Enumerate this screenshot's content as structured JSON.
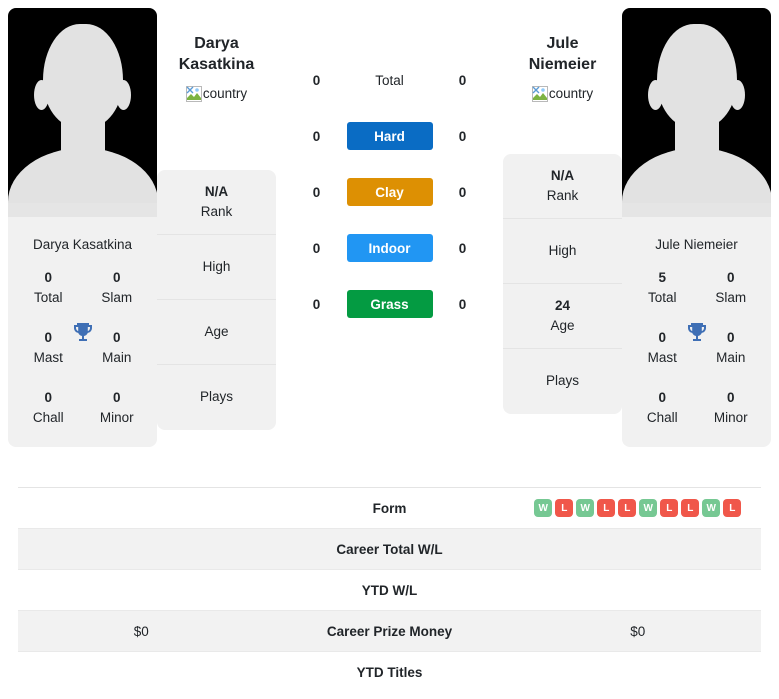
{
  "players": {
    "left": {
      "name": "Darya Kasatkina",
      "name_line1": "Darya",
      "name_line2": "Kasatkina",
      "country_alt": "country",
      "card_name": "Darya Kasatkina",
      "titles": [
        {
          "num": "0",
          "lbl": "Total"
        },
        {
          "num": "0",
          "lbl": "Slam"
        },
        {
          "num": "0",
          "lbl": "Mast"
        },
        {
          "num": "0",
          "lbl": "Main"
        },
        {
          "num": "0",
          "lbl": "Chall"
        },
        {
          "num": "0",
          "lbl": "Minor"
        }
      ],
      "info": [
        {
          "value": "N/A",
          "label": "Rank"
        },
        {
          "value": "",
          "label": "High"
        },
        {
          "value": "",
          "label": "Age"
        },
        {
          "value": "",
          "label": "Plays"
        }
      ]
    },
    "right": {
      "name": "Jule Niemeier",
      "name_line1": "Jule",
      "name_line2": "Niemeier",
      "country_alt": "country",
      "card_name": "Jule Niemeier",
      "titles": [
        {
          "num": "5",
          "lbl": "Total"
        },
        {
          "num": "0",
          "lbl": "Slam"
        },
        {
          "num": "0",
          "lbl": "Mast"
        },
        {
          "num": "0",
          "lbl": "Main"
        },
        {
          "num": "0",
          "lbl": "Chall"
        },
        {
          "num": "0",
          "lbl": "Minor"
        }
      ],
      "info": [
        {
          "value": "N/A",
          "label": "Rank"
        },
        {
          "value": "",
          "label": "High"
        },
        {
          "value": "24",
          "label": "Age"
        },
        {
          "value": "",
          "label": "Plays"
        }
      ]
    }
  },
  "surfaces": [
    {
      "label": "Total",
      "left": "0",
      "right": "0",
      "color": "transparent",
      "plain": true
    },
    {
      "label": "Hard",
      "left": "0",
      "right": "0",
      "color": "#0a6cc4",
      "plain": false
    },
    {
      "label": "Clay",
      "left": "0",
      "right": "0",
      "color": "#dd9003",
      "plain": false
    },
    {
      "label": "Indoor",
      "left": "0",
      "right": "0",
      "color": "#2196f3",
      "plain": false
    },
    {
      "label": "Grass",
      "left": "0",
      "right": "0",
      "color": "#049b42",
      "plain": false
    }
  ],
  "table": {
    "rows": [
      {
        "label": "Form",
        "left": "",
        "right": "",
        "type": "form"
      },
      {
        "label": "Career Total W/L",
        "left": "",
        "right": "",
        "type": "text"
      },
      {
        "label": "YTD W/L",
        "left": "",
        "right": "",
        "type": "text"
      },
      {
        "label": "Career Prize Money",
        "left": "$0",
        "right": "$0",
        "type": "text"
      },
      {
        "label": "YTD Titles",
        "left": "",
        "right": "",
        "type": "text"
      }
    ],
    "form_right": [
      "W",
      "L",
      "W",
      "L",
      "L",
      "W",
      "L",
      "L",
      "W",
      "L"
    ],
    "form_left": []
  },
  "colors": {
    "win": "#76c893",
    "loss": "#f0574a",
    "trophy": "#3f6fb5",
    "card_bg": "#f1f1f1",
    "alt_row": "#f2f2f2"
  }
}
